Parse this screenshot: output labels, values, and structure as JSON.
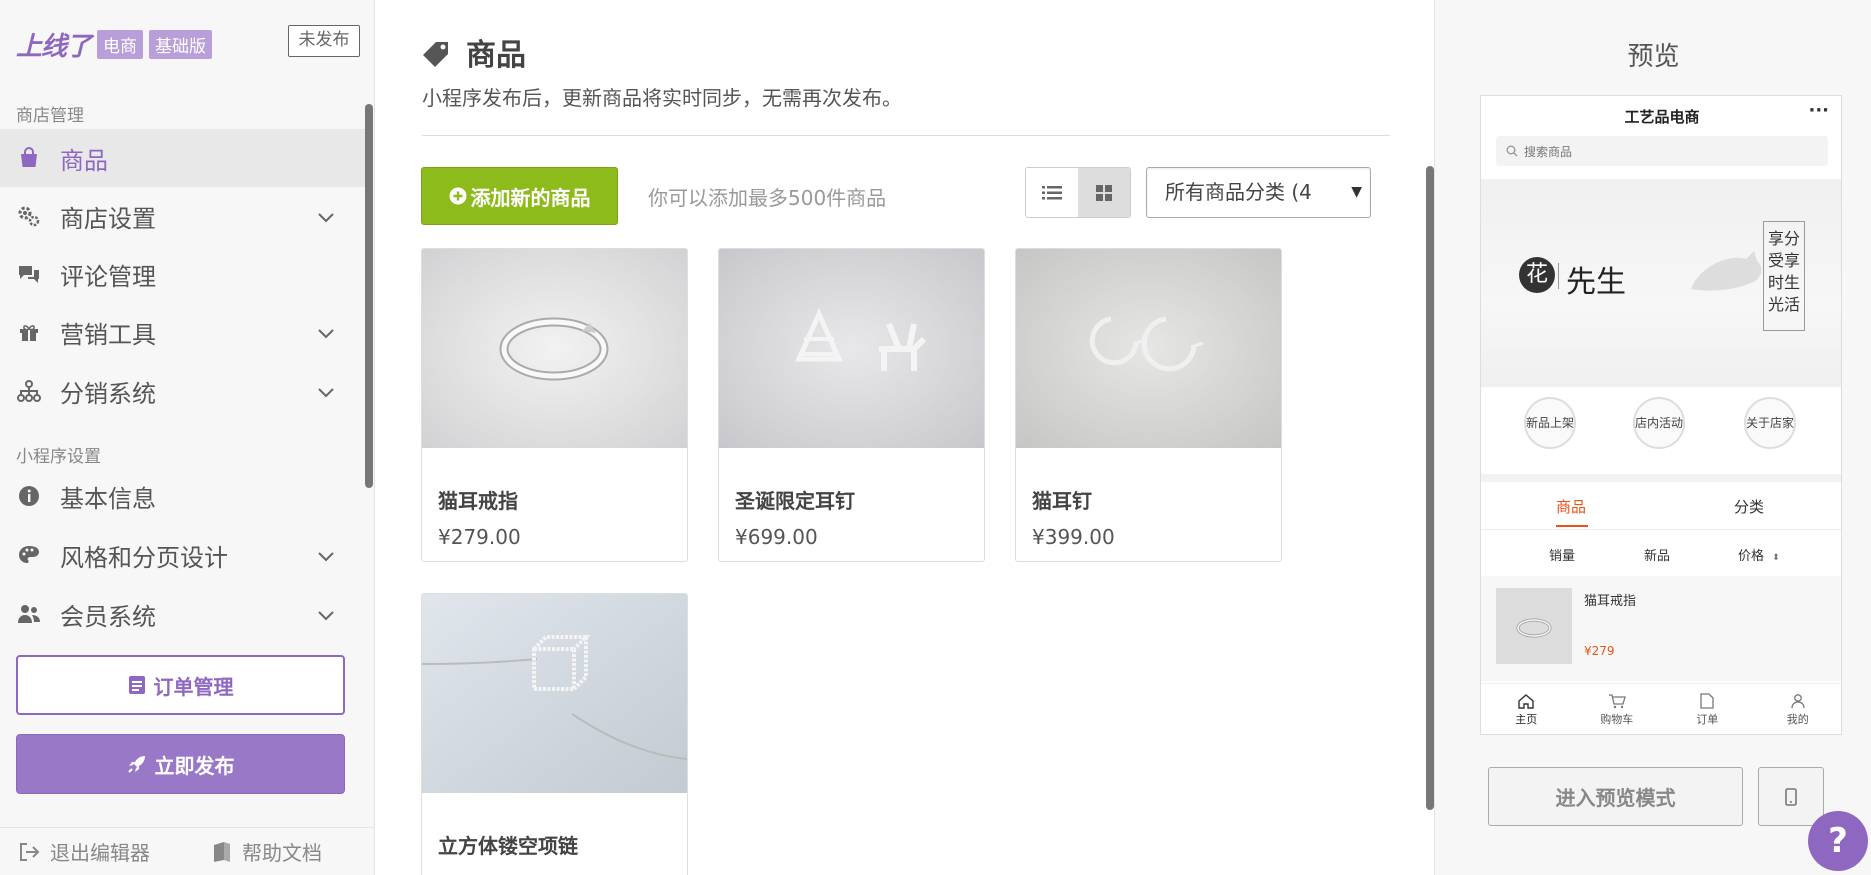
{
  "brand": {
    "logo": "上线了",
    "tag1": "电商",
    "tag2": "基础版",
    "status": "未发布"
  },
  "sidebar": {
    "section1": "商店管理",
    "section2": "小程序设置",
    "items": [
      {
        "label": "商品",
        "icon": "shopping-bag-icon"
      },
      {
        "label": "商店设置",
        "icon": "gears-icon"
      },
      {
        "label": "评论管理",
        "icon": "comments-icon"
      },
      {
        "label": "营销工具",
        "icon": "gift-icon"
      },
      {
        "label": "分销系统",
        "icon": "sitemap-icon"
      },
      {
        "label": "基本信息",
        "icon": "info-icon"
      },
      {
        "label": "风格和分页设计",
        "icon": "palette-icon"
      },
      {
        "label": "会员系统",
        "icon": "users-icon"
      }
    ],
    "orders_label": "订单管理",
    "publish_label": "立即发布",
    "exit_label": "退出编辑器",
    "help_label": "帮助文档"
  },
  "main": {
    "title": "商品",
    "subtitle": "小程序发布后，更新商品将实时同步，无需再次发布。",
    "add_label": "添加新的商品",
    "add_hint": "你可以添加最多500件商品",
    "category_select": "所有商品分类 (4",
    "products": [
      {
        "name": "猫耳戒指",
        "price": "¥279.00"
      },
      {
        "name": "圣诞限定耳钉",
        "price": "¥699.00"
      },
      {
        "name": "猫耳钉",
        "price": "¥399.00"
      },
      {
        "name": "立方体镂空项链",
        "price": ""
      }
    ]
  },
  "preview": {
    "title": "预览",
    "app_title": "工艺品电商",
    "more": "···",
    "search_placeholder": "搜索商品",
    "banner_logo": "花",
    "banner_name": "先生",
    "banner_poem": "享分受享时生光活",
    "circles": [
      "新品上架",
      "店内活动",
      "关于店家"
    ],
    "tabs": [
      "商品",
      "分类"
    ],
    "sorts": [
      "销量",
      "新品",
      "价格"
    ],
    "product": {
      "name": "猫耳戒指",
      "price": "¥279"
    },
    "nav": [
      "主页",
      "购物车",
      "订单",
      "我的"
    ],
    "enter_preview": "进入预览模式"
  },
  "help_fab": "?",
  "colors": {
    "accent": "#8e68c0",
    "add_green": "#8ebb1c",
    "price_orange": "#e8531a"
  }
}
